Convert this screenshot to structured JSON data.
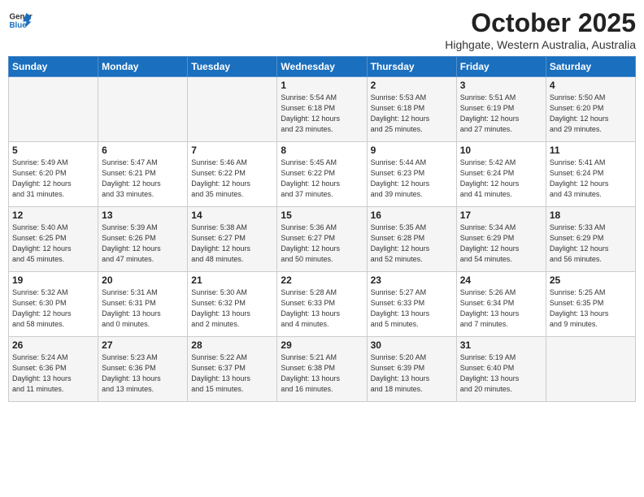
{
  "header": {
    "logo_line1": "General",
    "logo_line2": "Blue",
    "month": "October 2025",
    "location": "Highgate, Western Australia, Australia"
  },
  "weekdays": [
    "Sunday",
    "Monday",
    "Tuesday",
    "Wednesday",
    "Thursday",
    "Friday",
    "Saturday"
  ],
  "weeks": [
    [
      {
        "day": "",
        "info": ""
      },
      {
        "day": "",
        "info": ""
      },
      {
        "day": "",
        "info": ""
      },
      {
        "day": "1",
        "info": "Sunrise: 5:54 AM\nSunset: 6:18 PM\nDaylight: 12 hours\nand 23 minutes."
      },
      {
        "day": "2",
        "info": "Sunrise: 5:53 AM\nSunset: 6:18 PM\nDaylight: 12 hours\nand 25 minutes."
      },
      {
        "day": "3",
        "info": "Sunrise: 5:51 AM\nSunset: 6:19 PM\nDaylight: 12 hours\nand 27 minutes."
      },
      {
        "day": "4",
        "info": "Sunrise: 5:50 AM\nSunset: 6:20 PM\nDaylight: 12 hours\nand 29 minutes."
      }
    ],
    [
      {
        "day": "5",
        "info": "Sunrise: 5:49 AM\nSunset: 6:20 PM\nDaylight: 12 hours\nand 31 minutes."
      },
      {
        "day": "6",
        "info": "Sunrise: 5:47 AM\nSunset: 6:21 PM\nDaylight: 12 hours\nand 33 minutes."
      },
      {
        "day": "7",
        "info": "Sunrise: 5:46 AM\nSunset: 6:22 PM\nDaylight: 12 hours\nand 35 minutes."
      },
      {
        "day": "8",
        "info": "Sunrise: 5:45 AM\nSunset: 6:22 PM\nDaylight: 12 hours\nand 37 minutes."
      },
      {
        "day": "9",
        "info": "Sunrise: 5:44 AM\nSunset: 6:23 PM\nDaylight: 12 hours\nand 39 minutes."
      },
      {
        "day": "10",
        "info": "Sunrise: 5:42 AM\nSunset: 6:24 PM\nDaylight: 12 hours\nand 41 minutes."
      },
      {
        "day": "11",
        "info": "Sunrise: 5:41 AM\nSunset: 6:24 PM\nDaylight: 12 hours\nand 43 minutes."
      }
    ],
    [
      {
        "day": "12",
        "info": "Sunrise: 5:40 AM\nSunset: 6:25 PM\nDaylight: 12 hours\nand 45 minutes."
      },
      {
        "day": "13",
        "info": "Sunrise: 5:39 AM\nSunset: 6:26 PM\nDaylight: 12 hours\nand 47 minutes."
      },
      {
        "day": "14",
        "info": "Sunrise: 5:38 AM\nSunset: 6:27 PM\nDaylight: 12 hours\nand 48 minutes."
      },
      {
        "day": "15",
        "info": "Sunrise: 5:36 AM\nSunset: 6:27 PM\nDaylight: 12 hours\nand 50 minutes."
      },
      {
        "day": "16",
        "info": "Sunrise: 5:35 AM\nSunset: 6:28 PM\nDaylight: 12 hours\nand 52 minutes."
      },
      {
        "day": "17",
        "info": "Sunrise: 5:34 AM\nSunset: 6:29 PM\nDaylight: 12 hours\nand 54 minutes."
      },
      {
        "day": "18",
        "info": "Sunrise: 5:33 AM\nSunset: 6:29 PM\nDaylight: 12 hours\nand 56 minutes."
      }
    ],
    [
      {
        "day": "19",
        "info": "Sunrise: 5:32 AM\nSunset: 6:30 PM\nDaylight: 12 hours\nand 58 minutes."
      },
      {
        "day": "20",
        "info": "Sunrise: 5:31 AM\nSunset: 6:31 PM\nDaylight: 13 hours\nand 0 minutes."
      },
      {
        "day": "21",
        "info": "Sunrise: 5:30 AM\nSunset: 6:32 PM\nDaylight: 13 hours\nand 2 minutes."
      },
      {
        "day": "22",
        "info": "Sunrise: 5:28 AM\nSunset: 6:33 PM\nDaylight: 13 hours\nand 4 minutes."
      },
      {
        "day": "23",
        "info": "Sunrise: 5:27 AM\nSunset: 6:33 PM\nDaylight: 13 hours\nand 5 minutes."
      },
      {
        "day": "24",
        "info": "Sunrise: 5:26 AM\nSunset: 6:34 PM\nDaylight: 13 hours\nand 7 minutes."
      },
      {
        "day": "25",
        "info": "Sunrise: 5:25 AM\nSunset: 6:35 PM\nDaylight: 13 hours\nand 9 minutes."
      }
    ],
    [
      {
        "day": "26",
        "info": "Sunrise: 5:24 AM\nSunset: 6:36 PM\nDaylight: 13 hours\nand 11 minutes."
      },
      {
        "day": "27",
        "info": "Sunrise: 5:23 AM\nSunset: 6:36 PM\nDaylight: 13 hours\nand 13 minutes."
      },
      {
        "day": "28",
        "info": "Sunrise: 5:22 AM\nSunset: 6:37 PM\nDaylight: 13 hours\nand 15 minutes."
      },
      {
        "day": "29",
        "info": "Sunrise: 5:21 AM\nSunset: 6:38 PM\nDaylight: 13 hours\nand 16 minutes."
      },
      {
        "day": "30",
        "info": "Sunrise: 5:20 AM\nSunset: 6:39 PM\nDaylight: 13 hours\nand 18 minutes."
      },
      {
        "day": "31",
        "info": "Sunrise: 5:19 AM\nSunset: 6:40 PM\nDaylight: 13 hours\nand 20 minutes."
      },
      {
        "day": "",
        "info": ""
      }
    ]
  ]
}
